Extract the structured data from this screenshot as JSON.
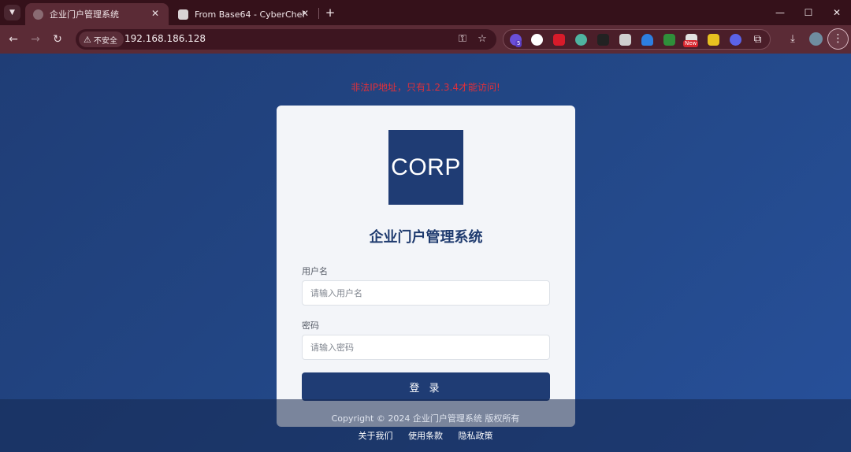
{
  "browser": {
    "tabs": [
      {
        "title": "企业门户管理系统",
        "active": true
      },
      {
        "title": "From Base64 - CyberChef",
        "active": false
      }
    ],
    "close_glyph": "✕",
    "new_tab_glyph": "+",
    "window_controls": {
      "minimize": "—",
      "maximize": "☐",
      "close": "✕"
    },
    "address_bar": {
      "security_label": "不安全",
      "url": "192.168.186.128"
    },
    "extensions": [
      {
        "icon": "extension-1-icon",
        "color": "#6a4fd8",
        "badge": "5"
      },
      {
        "icon": "extension-2-icon",
        "color": "#ffffff"
      },
      {
        "icon": "extension-3-icon",
        "color": "#d81b2a"
      },
      {
        "icon": "extension-4-icon",
        "color": "#4fb3a0"
      },
      {
        "icon": "extension-5-icon",
        "color": "#222222"
      },
      {
        "icon": "extension-6-icon",
        "color": "#cfcfcf"
      },
      {
        "icon": "extension-7-icon",
        "color": "#2d7fe0"
      },
      {
        "icon": "extension-8-icon",
        "color": "#2f8f3a"
      },
      {
        "icon": "extension-9-icon",
        "color": "#e2e2e2",
        "badge": "New"
      },
      {
        "icon": "extension-10-icon",
        "color": "#e8c020"
      },
      {
        "icon": "extension-11-icon",
        "color": "#5b63e8"
      }
    ],
    "colors": {
      "tabbar": "#35111a",
      "toolbar": "#5b2b36"
    }
  },
  "page": {
    "error_message": "非法IP地址，只有1.2.3.4才能访问!",
    "logo_text": "CORP",
    "system_title": "企业门户管理系统",
    "username": {
      "label": "用户名",
      "placeholder": "请输入用户名",
      "value": ""
    },
    "password": {
      "label": "密码",
      "placeholder": "请输入密码",
      "value": ""
    },
    "login_button": "登 录",
    "footer": {
      "copyright": "Copyright © 2024 企业门户管理系统 版权所有",
      "links": [
        "关于我们",
        "使用条款",
        "隐私政策"
      ]
    },
    "colors": {
      "primary": "#1f3c74",
      "error": "#e0303a",
      "card": "#f3f5f9"
    }
  }
}
